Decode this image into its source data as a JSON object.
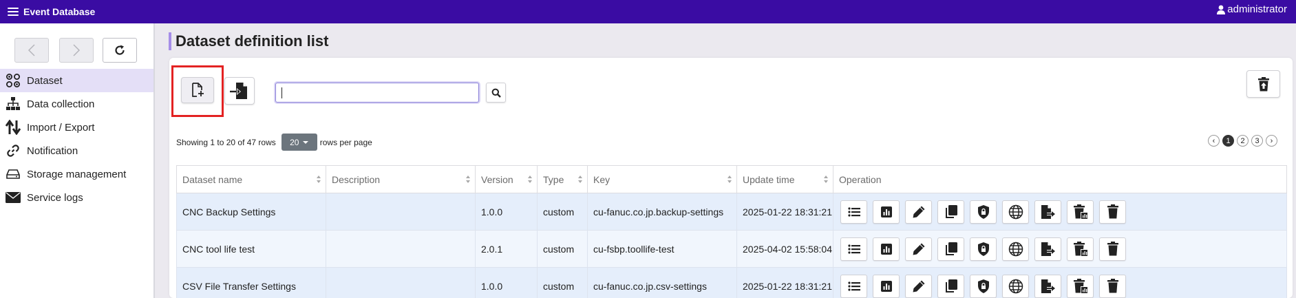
{
  "app": {
    "title": "Event Database",
    "user": "administrator"
  },
  "sidebar": {
    "items": [
      {
        "label": "Dataset",
        "icon": "dataset-icon",
        "active": true
      },
      {
        "label": "Data collection",
        "icon": "data-collection-icon",
        "active": false
      },
      {
        "label": "Import / Export",
        "icon": "import-export-icon",
        "active": false
      },
      {
        "label": "Notification",
        "icon": "link-icon",
        "active": false
      },
      {
        "label": "Storage management",
        "icon": "storage-icon",
        "active": false
      },
      {
        "label": "Service logs",
        "icon": "envelope-icon",
        "active": false
      }
    ]
  },
  "page": {
    "title": "Dataset definition list"
  },
  "search": {
    "value": ""
  },
  "pagination": {
    "showing_text": "Showing 1 to 20 of 47 rows",
    "rows_per_page": "20",
    "rows_per_page_suffix": "rows per page",
    "pages": [
      "1",
      "2",
      "3"
    ],
    "current_page": "1",
    "prev": "‹",
    "next": "›"
  },
  "table": {
    "columns": [
      "Dataset name",
      "Description",
      "Version",
      "Type",
      "Key",
      "Update time",
      "Operation"
    ],
    "rows": [
      {
        "name": "CNC Backup Settings",
        "description": "",
        "version": "1.0.0",
        "type": "custom",
        "key": "cu-fanuc.co.jp.backup-settings",
        "updated": "2025-01-22 18:31:21"
      },
      {
        "name": "CNC tool life test",
        "description": "",
        "version": "2.0.1",
        "type": "custom",
        "key": "cu-fsbp.toollife-test",
        "updated": "2025-04-02 15:58:04"
      },
      {
        "name": "CSV File Transfer Settings",
        "description": "",
        "version": "1.0.0",
        "type": "custom",
        "key": "cu-fanuc.co.jp.csv-settings",
        "updated": "2025-01-22 18:31:21"
      }
    ],
    "operations": [
      "list-icon",
      "chart-icon",
      "pencil-icon",
      "copy-icon",
      "lock-shield-icon",
      "globe-icon",
      "export-file-icon",
      "delete-data-icon",
      "trash-icon"
    ]
  },
  "colors": {
    "header": "#3a0ca3",
    "accent": "#a58de8",
    "highlight": "#e32222",
    "row_odd": "#e5eefb",
    "row_even": "#f1f6fd"
  }
}
